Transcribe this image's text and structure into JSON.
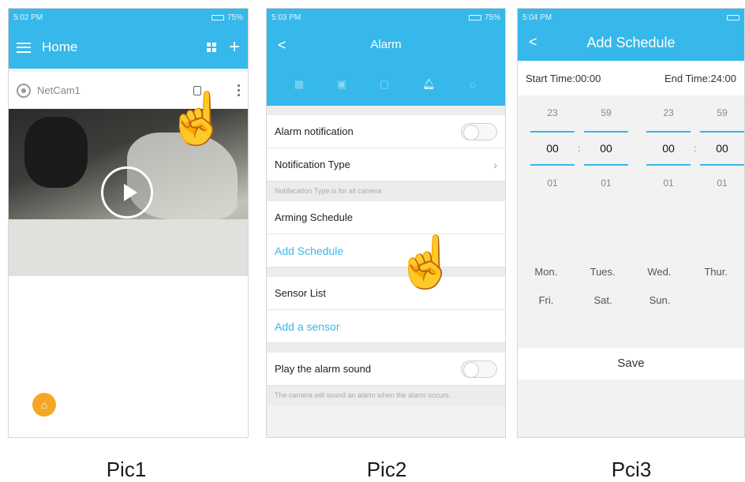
{
  "pic1": {
    "status_time": "5:02 PM",
    "status_battery": "75%",
    "title": "Home",
    "camera_name": "NetCam1",
    "caption": "Pic1"
  },
  "pic2": {
    "status_time": "5:03 PM",
    "status_battery": "75%",
    "title": "Alarm",
    "back": "<",
    "rows": {
      "alarm_notification": "Alarm notification",
      "notification_type": "Notification Type",
      "notification_note": "Notifacation Type is for all camera",
      "arming_schedule": "Arming Schedule",
      "add_schedule": "Add Schedule",
      "sensor_list": "Sensor List",
      "add_sensor": "Add a sensor",
      "play_sound": "Play the alarm sound",
      "sound_note": "The camera will sound an alarm when the alarm occurs."
    },
    "caption": "Pic2"
  },
  "pic3": {
    "status_time": "5:04 PM",
    "title": "Add Schedule",
    "back": "<",
    "start_time": "Start Time:00:00",
    "end_time": "End Time:24:00",
    "picker": {
      "col1": [
        "23",
        "00",
        "01"
      ],
      "col2": [
        "59",
        "00",
        "01"
      ],
      "col3": [
        "23",
        "00",
        "01"
      ],
      "col4": [
        "59",
        "00",
        "01"
      ]
    },
    "colon": ":",
    "days_row1": [
      "Mon.",
      "Tues.",
      "Wed.",
      "Thur."
    ],
    "days_row2": [
      "Fri.",
      "Sat.",
      "Sun."
    ],
    "save": "Save",
    "caption": "Pci3"
  }
}
